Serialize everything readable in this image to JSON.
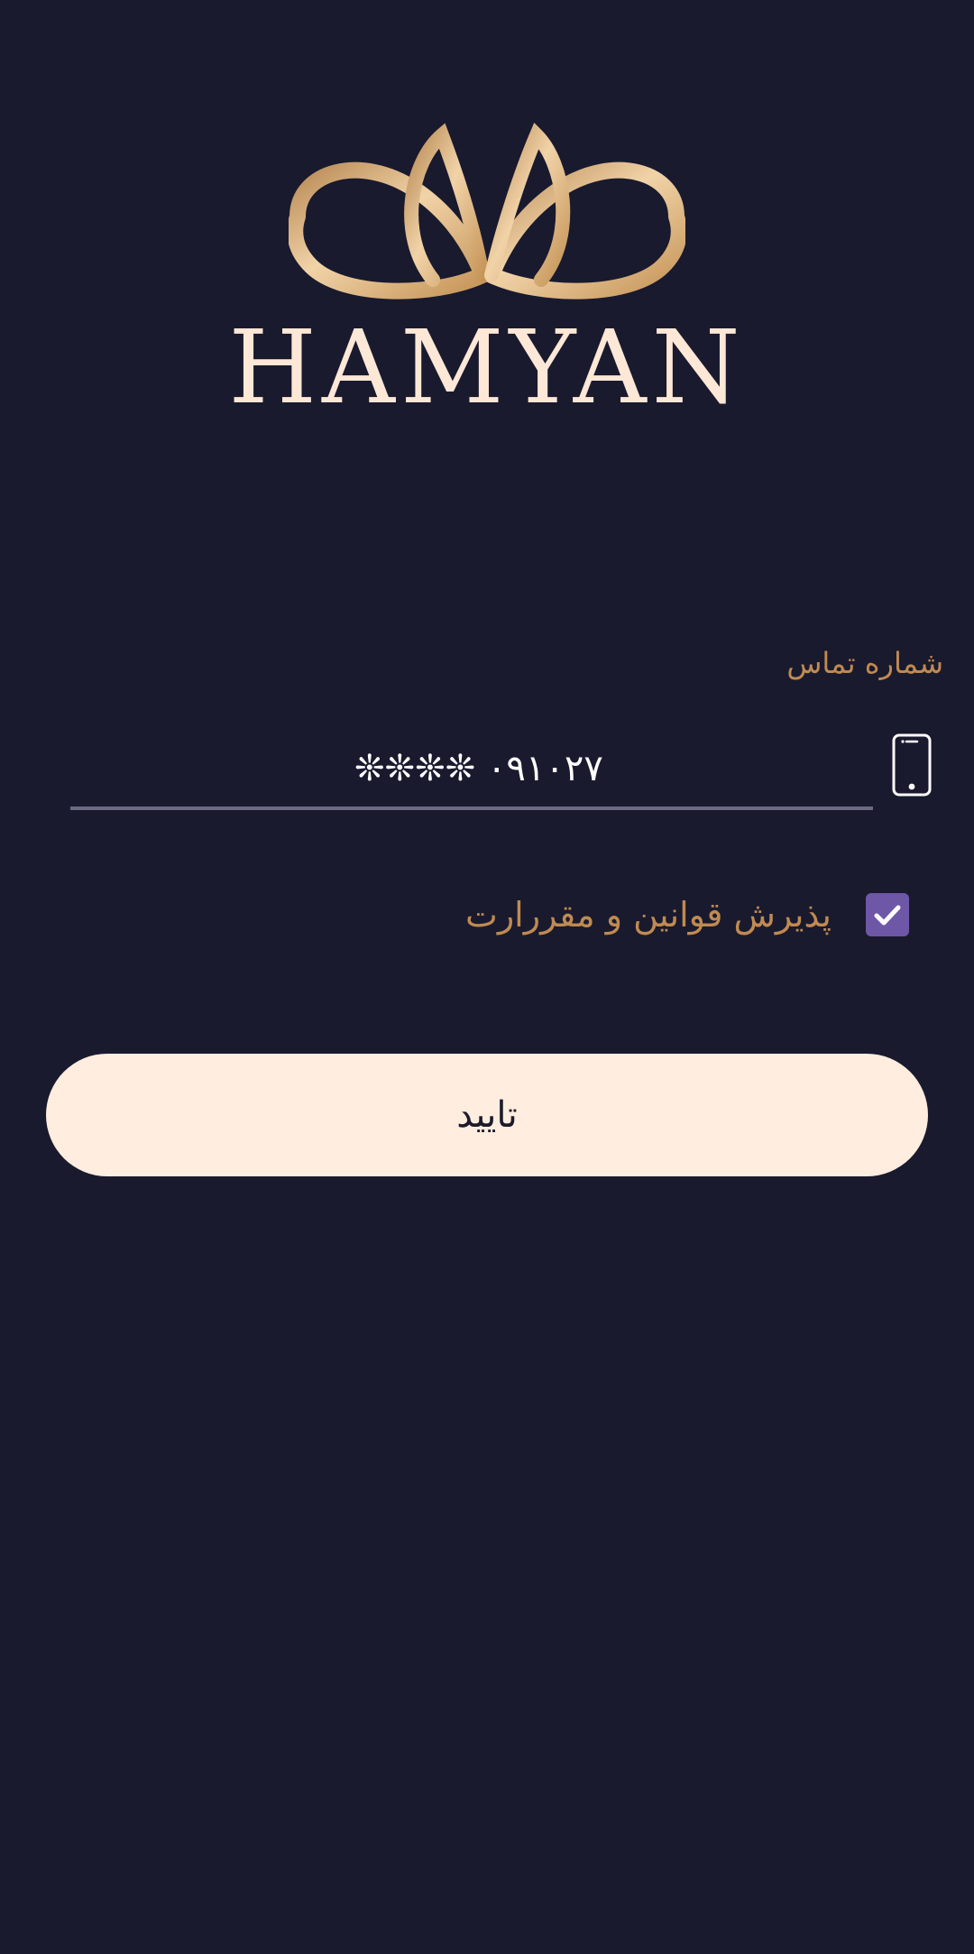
{
  "brand": {
    "wordmark": "HAMYAN",
    "logo_icon": "ribbon-lotus-icon",
    "gold": "#d1a46a",
    "cream": "#fde7d6"
  },
  "form": {
    "phone_label": "شماره تماس",
    "phone_value": "۰۹۱۰۲۷ ❊❊❊❊",
    "phone_icon": "mobile-phone-icon",
    "terms_label": "پذیرش قوانین و مقررارت",
    "terms_checked": true,
    "checkbox_icon": "check-icon",
    "submit_label": "تایید"
  },
  "colors": {
    "background": "#191a2e",
    "accent_text": "#c08a52",
    "checkbox": "#6f57a7",
    "button": "#ffeddf",
    "underline": "#6b6a82"
  }
}
